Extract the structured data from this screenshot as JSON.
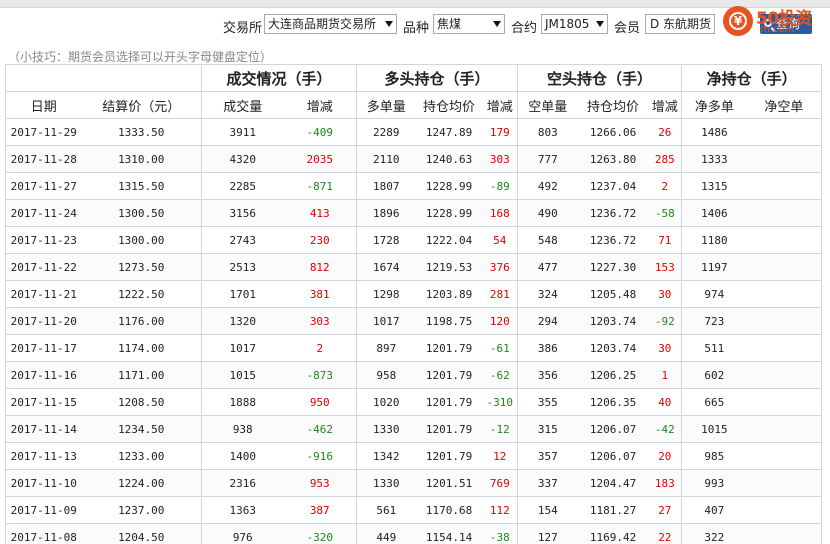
{
  "filters": {
    "exchange_label": "交易所",
    "exchange_value": "大连商品期货交易所",
    "product_label": "品种",
    "product_value": "焦煤",
    "contract_label": "合约",
    "contract_value": "JM1805",
    "member_label": "会员",
    "member_value": "D 东航期货",
    "query_label": "查询"
  },
  "logo": {
    "text": "50投资",
    "domain": "m.com"
  },
  "tip": "（小技巧：期货会员选择可以开头字母健盘定位）",
  "groups": {
    "volume": "成交情况（手）",
    "long": "多头持仓（手）",
    "short": "空头持仓（手）",
    "net": "净持仓（手）"
  },
  "columns": {
    "date": "日期",
    "settle": "结算价（元）",
    "volume": "成交量",
    "vol_chg": "增减",
    "long_qty": "多单量",
    "long_avg": "持仓均价",
    "long_chg": "增减",
    "short_qty": "空单量",
    "short_avg": "持仓均价",
    "short_chg": "增减",
    "net_long": "净多单",
    "net_short": "净空单"
  },
  "colors": {
    "up": "#e00000",
    "down": "#1a8a1a",
    "accent": "#e8541e",
    "button": "#2c5aa0"
  },
  "rows": [
    {
      "date": "2017-11-29",
      "settle": "1333.50",
      "volume": "3911",
      "vol_chg": "-409",
      "long_qty": "2289",
      "long_avg": "1247.89",
      "long_chg": "179",
      "short_qty": "803",
      "short_avg": "1266.06",
      "short_chg": "26",
      "net_long": "1486",
      "net_short": ""
    },
    {
      "date": "2017-11-28",
      "settle": "1310.00",
      "volume": "4320",
      "vol_chg": "2035",
      "long_qty": "2110",
      "long_avg": "1240.63",
      "long_chg": "303",
      "short_qty": "777",
      "short_avg": "1263.80",
      "short_chg": "285",
      "net_long": "1333",
      "net_short": ""
    },
    {
      "date": "2017-11-27",
      "settle": "1315.50",
      "volume": "2285",
      "vol_chg": "-871",
      "long_qty": "1807",
      "long_avg": "1228.99",
      "long_chg": "-89",
      "short_qty": "492",
      "short_avg": "1237.04",
      "short_chg": "2",
      "net_long": "1315",
      "net_short": ""
    },
    {
      "date": "2017-11-24",
      "settle": "1300.50",
      "volume": "3156",
      "vol_chg": "413",
      "long_qty": "1896",
      "long_avg": "1228.99",
      "long_chg": "168",
      "short_qty": "490",
      "short_avg": "1236.72",
      "short_chg": "-58",
      "net_long": "1406",
      "net_short": ""
    },
    {
      "date": "2017-11-23",
      "settle": "1300.00",
      "volume": "2743",
      "vol_chg": "230",
      "long_qty": "1728",
      "long_avg": "1222.04",
      "long_chg": "54",
      "short_qty": "548",
      "short_avg": "1236.72",
      "short_chg": "71",
      "net_long": "1180",
      "net_short": ""
    },
    {
      "date": "2017-11-22",
      "settle": "1273.50",
      "volume": "2513",
      "vol_chg": "812",
      "long_qty": "1674",
      "long_avg": "1219.53",
      "long_chg": "376",
      "short_qty": "477",
      "short_avg": "1227.30",
      "short_chg": "153",
      "net_long": "1197",
      "net_short": ""
    },
    {
      "date": "2017-11-21",
      "settle": "1222.50",
      "volume": "1701",
      "vol_chg": "381",
      "long_qty": "1298",
      "long_avg": "1203.89",
      "long_chg": "281",
      "short_qty": "324",
      "short_avg": "1205.48",
      "short_chg": "30",
      "net_long": "974",
      "net_short": ""
    },
    {
      "date": "2017-11-20",
      "settle": "1176.00",
      "volume": "1320",
      "vol_chg": "303",
      "long_qty": "1017",
      "long_avg": "1198.75",
      "long_chg": "120",
      "short_qty": "294",
      "short_avg": "1203.74",
      "short_chg": "-92",
      "net_long": "723",
      "net_short": ""
    },
    {
      "date": "2017-11-17",
      "settle": "1174.00",
      "volume": "1017",
      "vol_chg": "2",
      "long_qty": "897",
      "long_avg": "1201.79",
      "long_chg": "-61",
      "short_qty": "386",
      "short_avg": "1203.74",
      "short_chg": "30",
      "net_long": "511",
      "net_short": ""
    },
    {
      "date": "2017-11-16",
      "settle": "1171.00",
      "volume": "1015",
      "vol_chg": "-873",
      "long_qty": "958",
      "long_avg": "1201.79",
      "long_chg": "-62",
      "short_qty": "356",
      "short_avg": "1206.25",
      "short_chg": "1",
      "net_long": "602",
      "net_short": ""
    },
    {
      "date": "2017-11-15",
      "settle": "1208.50",
      "volume": "1888",
      "vol_chg": "950",
      "long_qty": "1020",
      "long_avg": "1201.79",
      "long_chg": "-310",
      "short_qty": "355",
      "short_avg": "1206.35",
      "short_chg": "40",
      "net_long": "665",
      "net_short": ""
    },
    {
      "date": "2017-11-14",
      "settle": "1234.50",
      "volume": "938",
      "vol_chg": "-462",
      "long_qty": "1330",
      "long_avg": "1201.79",
      "long_chg": "-12",
      "short_qty": "315",
      "short_avg": "1206.07",
      "short_chg": "-42",
      "net_long": "1015",
      "net_short": ""
    },
    {
      "date": "2017-11-13",
      "settle": "1233.00",
      "volume": "1400",
      "vol_chg": "-916",
      "long_qty": "1342",
      "long_avg": "1201.79",
      "long_chg": "12",
      "short_qty": "357",
      "short_avg": "1206.07",
      "short_chg": "20",
      "net_long": "985",
      "net_short": ""
    },
    {
      "date": "2017-11-10",
      "settle": "1224.00",
      "volume": "2316",
      "vol_chg": "953",
      "long_qty": "1330",
      "long_avg": "1201.51",
      "long_chg": "769",
      "short_qty": "337",
      "short_avg": "1204.47",
      "short_chg": "183",
      "net_long": "993",
      "net_short": ""
    },
    {
      "date": "2017-11-09",
      "settle": "1237.00",
      "volume": "1363",
      "vol_chg": "387",
      "long_qty": "561",
      "long_avg": "1170.68",
      "long_chg": "112",
      "short_qty": "154",
      "short_avg": "1181.27",
      "short_chg": "27",
      "net_long": "407",
      "net_short": ""
    },
    {
      "date": "2017-11-08",
      "settle": "1204.50",
      "volume": "976",
      "vol_chg": "-320",
      "long_qty": "449",
      "long_avg": "1154.14",
      "long_chg": "-38",
      "short_qty": "127",
      "short_avg": "1169.42",
      "short_chg": "22",
      "net_long": "322",
      "net_short": ""
    }
  ]
}
